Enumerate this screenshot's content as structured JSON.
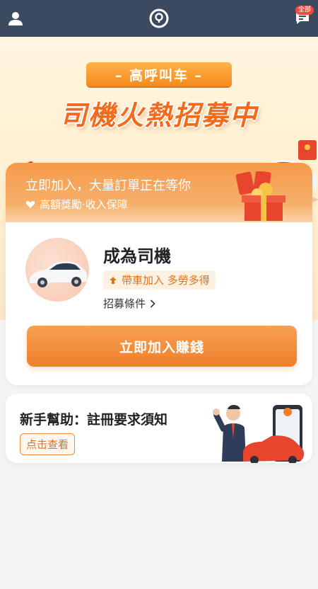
{
  "topbar": {
    "profile_icon": "user-icon",
    "logo_icon": "location-logo-icon",
    "message_icon": "chat-icon",
    "badge": "全部"
  },
  "hero": {
    "ribbon": "– 高呼叫车 –",
    "headline": "司機火熱招募中"
  },
  "card": {
    "header_title": "立即加入，大量訂單正在等你",
    "header_sub": "高額獎勵·收入保障",
    "driver_title": "成為司機",
    "tag": "帶車加入 多勞多得",
    "conditions": "招募條件",
    "join_button": "立即加入賺錢"
  },
  "help": {
    "title": "新手幫助：註冊要求須知",
    "button": "点击查看"
  },
  "colors": {
    "topbar": "#3b4a5e",
    "accent": "#f07f2a",
    "badge": "#f04a3a"
  }
}
